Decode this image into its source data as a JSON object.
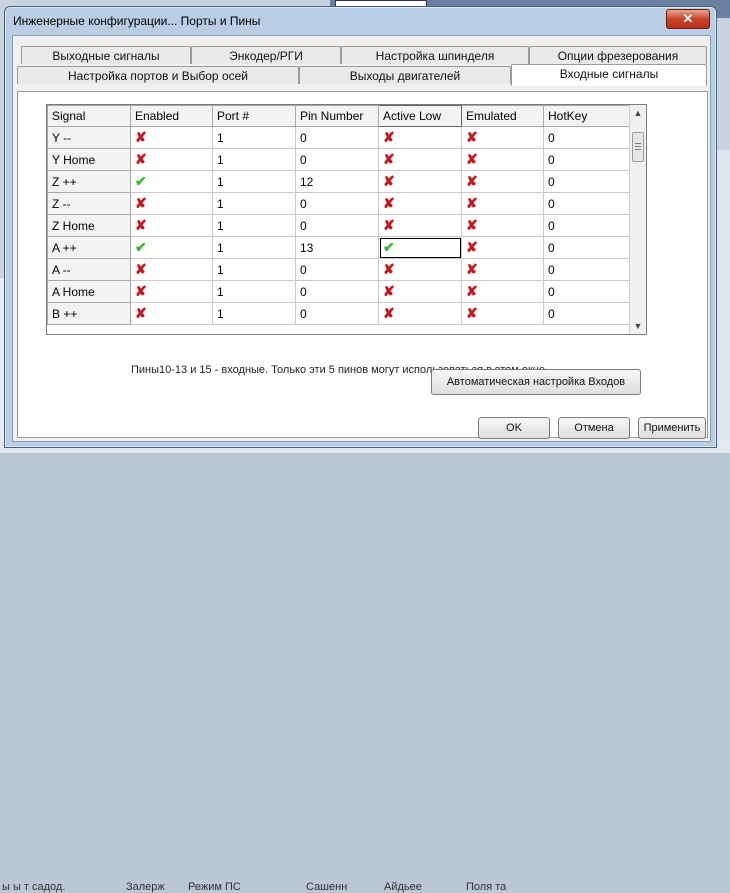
{
  "background": {
    "bottom_labels": [
      "ы ы т садод.",
      "Залерж",
      "Режим ПС",
      "Сашенн",
      "Айдьее",
      "Поля та"
    ]
  },
  "dialog": {
    "title": "Инженерные конфигурации... Порты и Пины",
    "close_symbol": "✕",
    "tabs_row1": [
      "Выходные сигналы",
      "Энкодер/РГИ",
      "Настройка шпинделя",
      "Опции фрезерования"
    ],
    "tabs_row2": [
      "Настройка портов и Выбор осей",
      "Выходы двигателей",
      "Входные сигналы"
    ],
    "active_tab": "Входные сигналы"
  },
  "grid": {
    "columns": [
      "Signal",
      "Enabled",
      "Port #",
      "Pin Number",
      "Active Low",
      "Emulated",
      "HotKey"
    ],
    "rows": [
      {
        "signal": "Y --",
        "enabled": "✘",
        "port": "1",
        "pin": "0",
        "active_low": "✘",
        "emulated": "✘",
        "hotkey": "0"
      },
      {
        "signal": "Y Home",
        "enabled": "✘",
        "port": "1",
        "pin": "0",
        "active_low": "✘",
        "emulated": "✘",
        "hotkey": "0"
      },
      {
        "signal": "Z ++",
        "enabled": "✔",
        "port": "1",
        "pin": "12",
        "active_low": "✘",
        "emulated": "✘",
        "hotkey": "0"
      },
      {
        "signal": "Z --",
        "enabled": "✘",
        "port": "1",
        "pin": "0",
        "active_low": "✘",
        "emulated": "✘",
        "hotkey": "0"
      },
      {
        "signal": "Z Home",
        "enabled": "✘",
        "port": "1",
        "pin": "0",
        "active_low": "✘",
        "emulated": "✘",
        "hotkey": "0"
      },
      {
        "signal": "A ++",
        "enabled": "✔",
        "port": "1",
        "pin": "13",
        "active_low": "✔",
        "emulated": "✘",
        "hotkey": "0"
      },
      {
        "signal": "A --",
        "enabled": "✘",
        "port": "1",
        "pin": "0",
        "active_low": "✘",
        "emulated": "✘",
        "hotkey": "0"
      },
      {
        "signal": "A Home",
        "enabled": "✘",
        "port": "1",
        "pin": "0",
        "active_low": "✘",
        "emulated": "✘",
        "hotkey": "0"
      },
      {
        "signal": "B ++",
        "enabled": "✘",
        "port": "1",
        "pin": "0",
        "active_low": "✘",
        "emulated": "✘",
        "hotkey": "0"
      }
    ],
    "scroll_up": "▲",
    "scroll_down": "▼"
  },
  "note": "Пины10-13 и 15 - входные. Только эти 5 пинов могут использоваться в этом окне.",
  "buttons": {
    "auto_config": "Автоматическая настройка Входов",
    "ok": "OK",
    "cancel": "Отмена",
    "apply": "Применить"
  },
  "colors": {
    "x_mark": "#c8161b",
    "check_mark": "#3bb532",
    "dialog_frame": "#b9cde5"
  }
}
